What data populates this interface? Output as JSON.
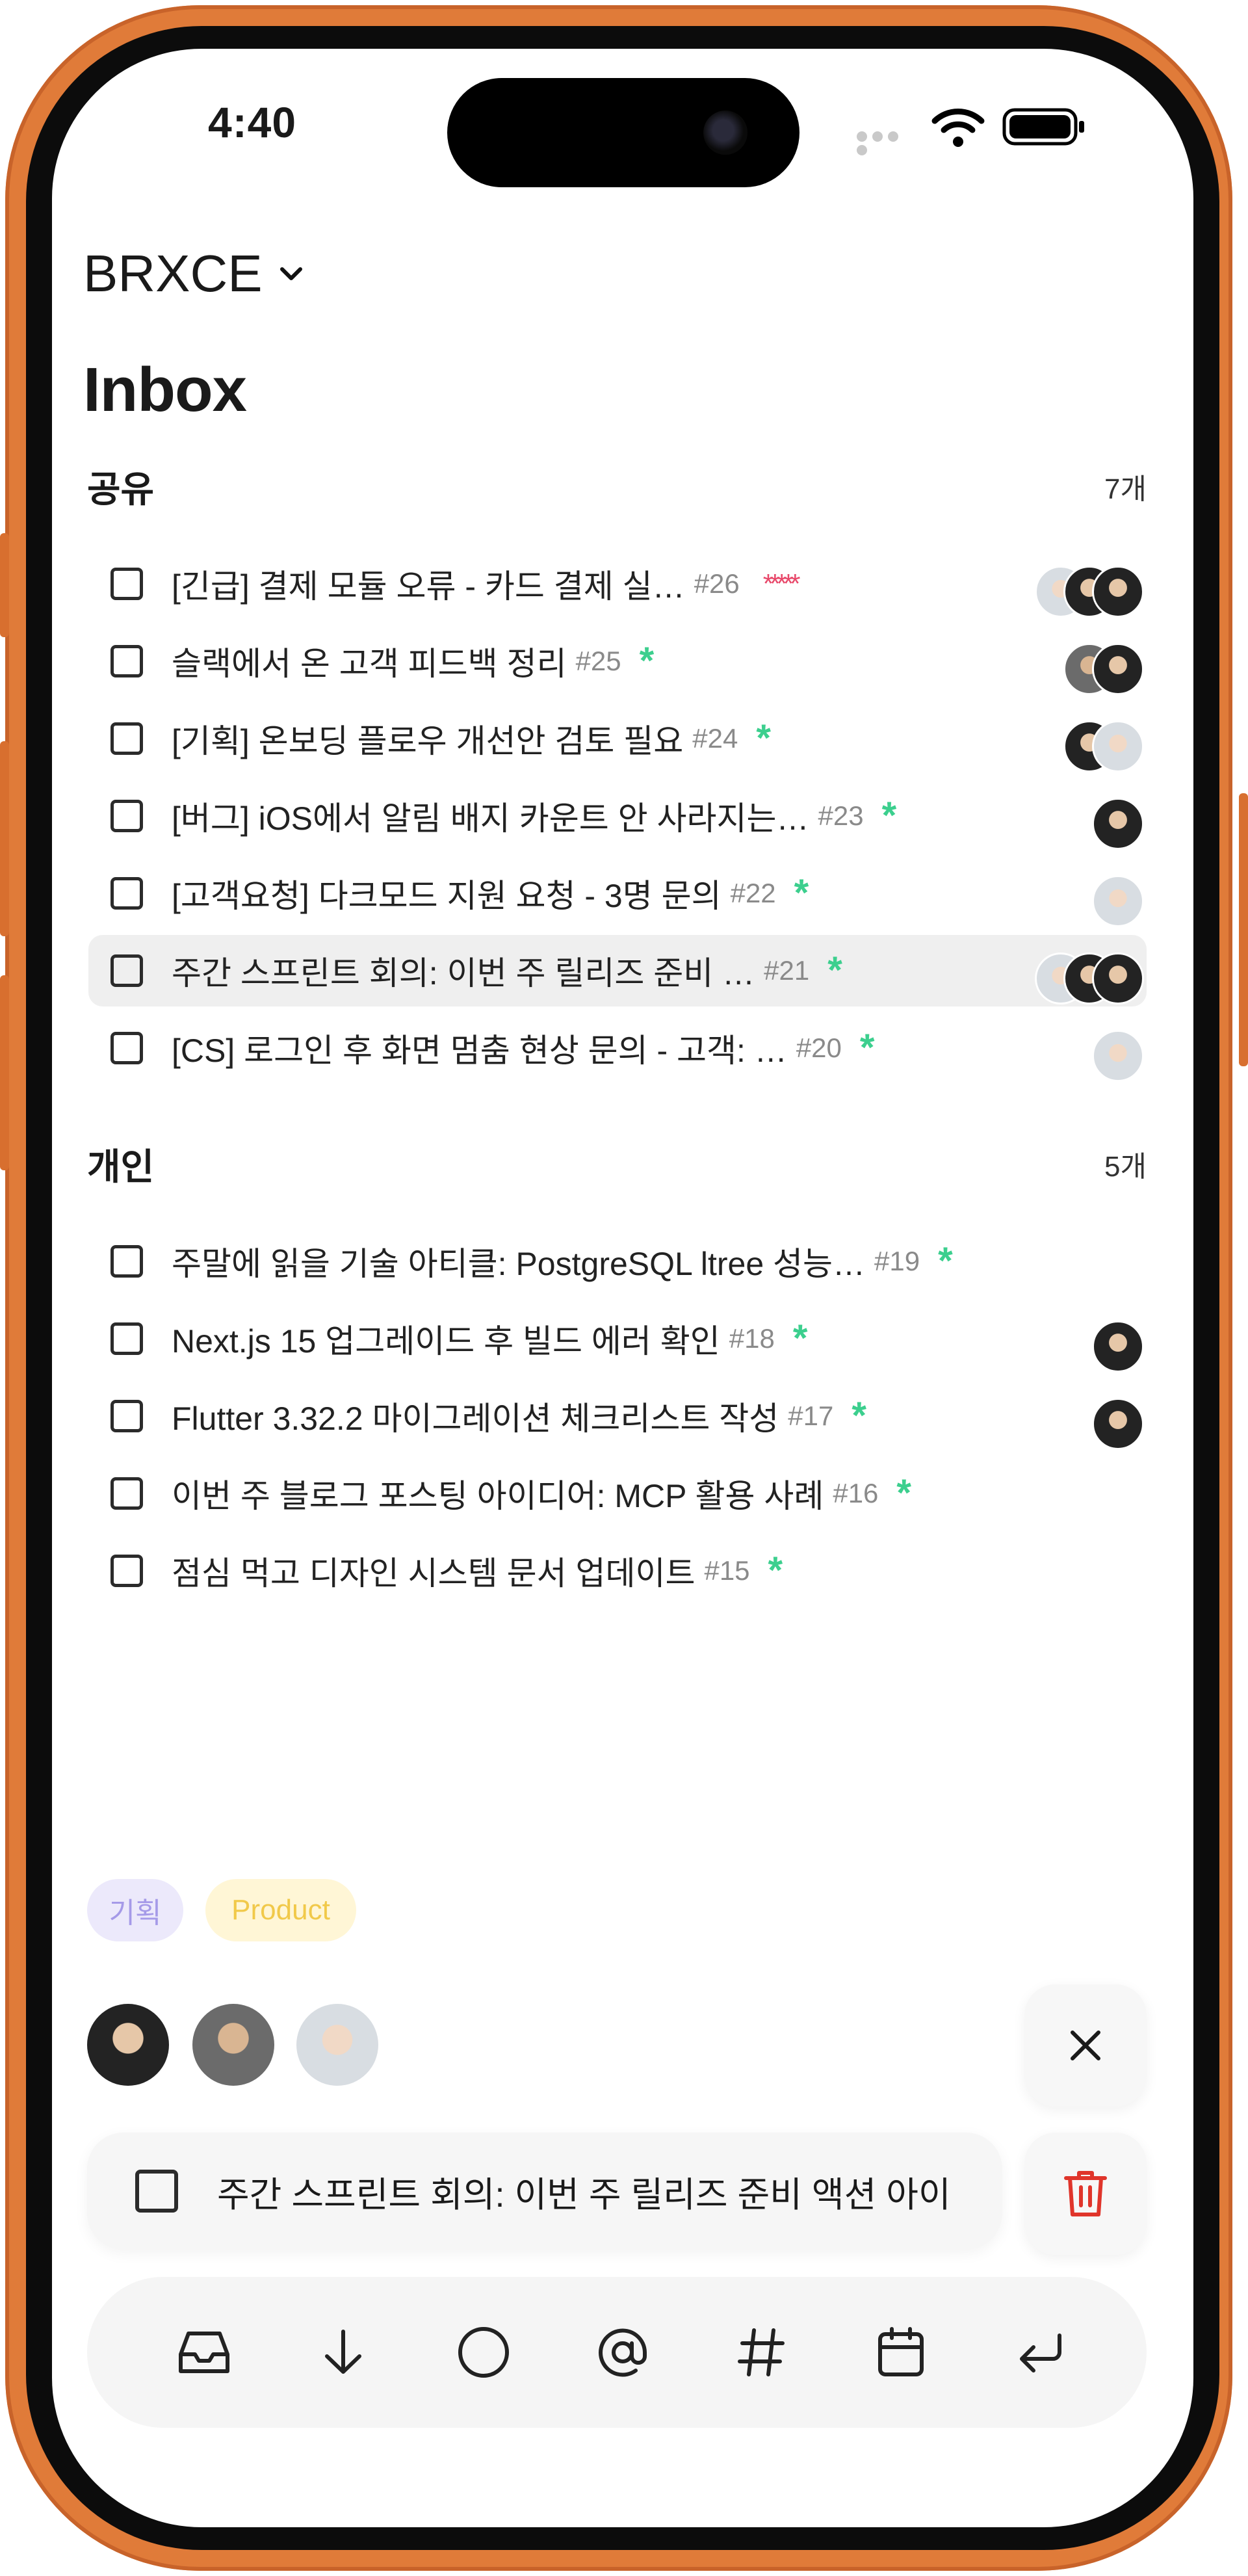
{
  "status_bar": {
    "time": "4:40"
  },
  "workspace": {
    "name": "BRXCE"
  },
  "page": {
    "title": "Inbox"
  },
  "sections": [
    {
      "title": "공유",
      "count": "7개",
      "items": [
        {
          "title": "[긴급] 결제 모듈 오류 - 카드 결제 실…",
          "number": "#26",
          "priority": "*****",
          "assignees": [
            "light",
            "dark",
            "dark"
          ]
        },
        {
          "title": "슬랙에서 온 고객 피드백 정리",
          "number": "#25",
          "priority": "*",
          "assignees": [
            "medium",
            "dark"
          ]
        },
        {
          "title": "[기획] 온보딩 플로우 개선안 검토 필요",
          "number": "#24",
          "priority": "*",
          "assignees": [
            "dark",
            "light"
          ]
        },
        {
          "title": "[버그] iOS에서 알림 배지 카운트 안 사라지는…",
          "number": "#23",
          "priority": "*",
          "assignees": [
            "dark"
          ]
        },
        {
          "title": "[고객요청] 다크모드 지원 요청 - 3명 문의",
          "number": "#22",
          "priority": "*",
          "assignees": [
            "light"
          ]
        },
        {
          "title": "주간 스프린트 회의: 이번 주 릴리즈 준비 …",
          "number": "#21",
          "priority": "*",
          "assignees": [
            "light",
            "dark",
            "dark"
          ],
          "selected": true
        },
        {
          "title": "[CS] 로그인 후 화면 멈춤 현상 문의 - 고객: …",
          "number": "#20",
          "priority": "*",
          "assignees": [
            "light"
          ]
        }
      ]
    },
    {
      "title": "개인",
      "count": "5개",
      "items": [
        {
          "title": "주말에 읽을 기술 아티클: PostgreSQL ltree 성능…",
          "number": "#19",
          "priority": "*",
          "assignees": []
        },
        {
          "title": "Next.js 15 업그레이드 후 빌드 에러 확인",
          "number": "#18",
          "priority": "*",
          "assignees": [
            "dark"
          ]
        },
        {
          "title": "Flutter 3.32.2 마이그레이션 체크리스트 작성",
          "number": "#17",
          "priority": "*",
          "assignees": [
            "dark"
          ]
        },
        {
          "title": "이번 주 블로그 포스팅 아이디어: MCP 활용 사례",
          "number": "#16",
          "priority": "*",
          "assignees": []
        },
        {
          "title": "점심 먹고 디자인 시스템 문서 업데이트",
          "number": "#15",
          "priority": "*",
          "assignees": []
        }
      ]
    }
  ],
  "editor": {
    "tags": [
      {
        "label": "기획",
        "color": "#a59ae8",
        "bg": "#ece9fb"
      },
      {
        "label": "Product",
        "color": "#f1c94a",
        "bg": "#fff6d6"
      }
    ],
    "assignees": [
      "dark",
      "medium",
      "light"
    ],
    "input_text": "주간 스프린트 회의: 이번 주 릴리즈 준비 액션 아이",
    "toolbar": [
      "inbox-icon",
      "arrow-down-icon",
      "circle-icon",
      "at-icon",
      "hash-icon",
      "calendar-icon",
      "return-icon"
    ]
  },
  "colors": {
    "frame": "#e07b39",
    "accent_green": "#3ccf8e",
    "priority_red": "#e8486a",
    "trash_red": "#e0352b"
  }
}
